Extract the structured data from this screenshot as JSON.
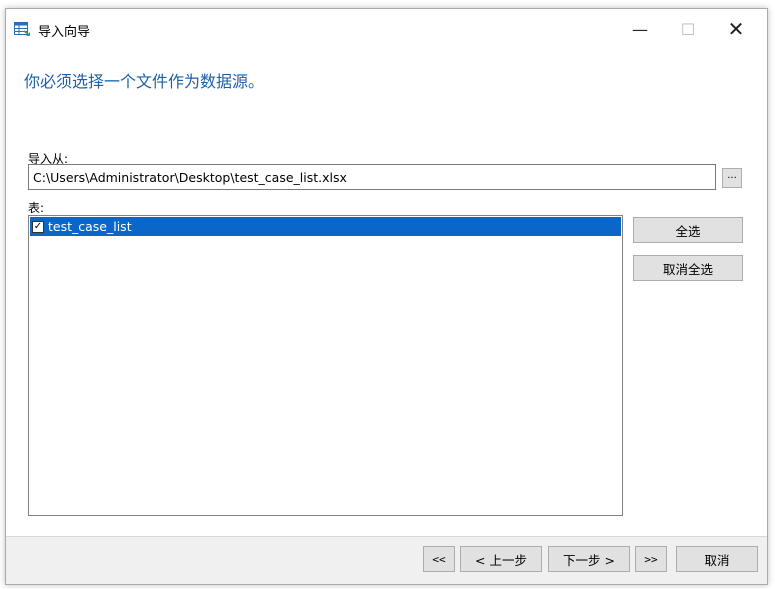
{
  "window": {
    "title": "导入向导",
    "minimize_glyph": "—",
    "maximize_glyph": "☐",
    "close_glyph": "✕",
    "app_icon": "table-import-icon"
  },
  "main": {
    "heading": "你必须选择一个文件作为数据源。",
    "import_from_label": "导入从:",
    "import_from_value": "C:\\Users\\Administrator\\Desktop\\test_case_list.xlsx",
    "browse_label": "...",
    "tables_label": "表:",
    "tables": [
      {
        "label": "test_case_list",
        "checked": true,
        "selected": true
      }
    ],
    "select_all_label": "全选",
    "deselect_all_label": "取消全选"
  },
  "footer": {
    "first_label": "<<",
    "prev_label": "< 上一步",
    "next_label": "下一步 >",
    "last_label": ">>",
    "cancel_label": "取消"
  },
  "colors": {
    "heading": "#1e5fa8",
    "selection": "#0a67c8"
  }
}
